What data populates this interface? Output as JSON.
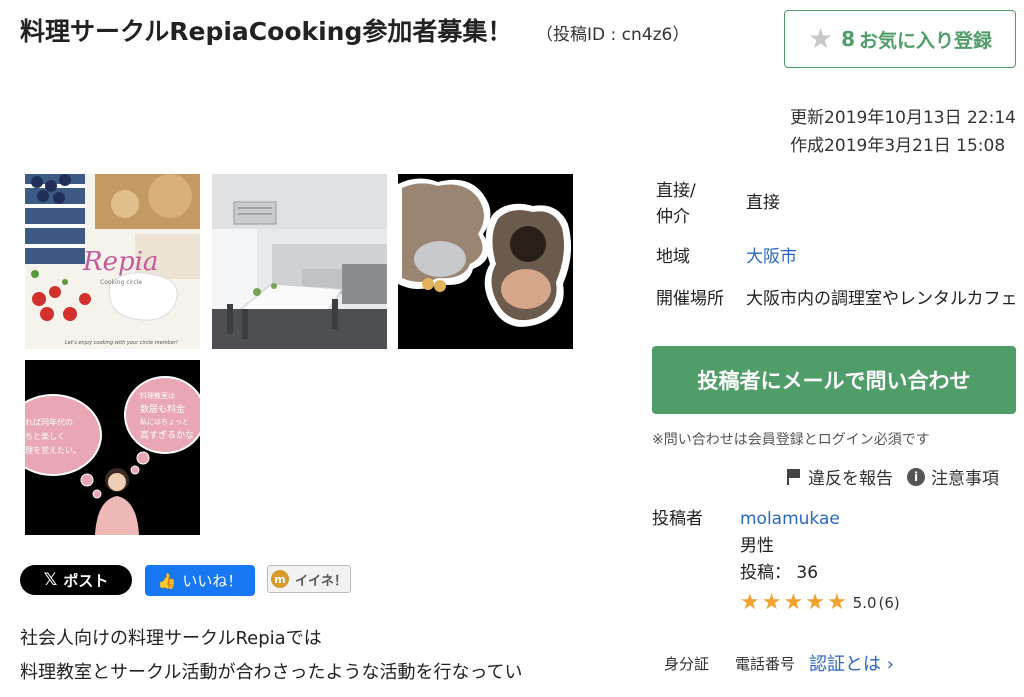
{
  "header": {
    "title": "料理サークルRepiaCooking参加者募集！",
    "post_id": "（投稿ID : cn4z6）"
  },
  "favorite": {
    "count": "8",
    "label": "お気に入り登録",
    "icon": "star-icon",
    "color": "#4f9d69"
  },
  "dates": {
    "updated": "更新2019年10月13日 22:14",
    "created": "作成2019年3月21日 15:08"
  },
  "gallery": {
    "img1_logo": "Repia",
    "img1_sub": "Cooking circle",
    "img1_caption": "Let's enjoy cooking with your circle member!",
    "img4_bubble_left": "れば同年代の\nちと楽しく\n理を覚えたい。",
    "img4_bubble_right": "料理教室は\n数居も料金\n私にはちょっと\n高すぎるかな"
  },
  "info": {
    "type_label": "直接/\n仲介",
    "type_value": "直接",
    "area_label": "地域",
    "area_value": "大阪市",
    "venue_label": "開催場所",
    "venue_value": "大阪市内の調理室やレンタルカフェ"
  },
  "contact": {
    "button_label": "投稿者にメールで問い合わせ",
    "note": "※問い合わせは会員登録とログイン必須です"
  },
  "report": {
    "report_label": "違反を報告",
    "notice_label": "注意事項"
  },
  "poster": {
    "label": "投稿者",
    "name": "molamukae",
    "gender": "男性",
    "posts": "投稿： 36",
    "rating": "5.0",
    "rating_count": "(6)",
    "stars": 5
  },
  "verification": {
    "id_label": "身分証",
    "phone_label": "電話番号",
    "link_label": "認証とは ›"
  },
  "share": {
    "x_label": "ポスト",
    "fb_label": "いいね！",
    "mixi_label": "イイネ！"
  },
  "description": [
    "社会人向けの料理サークルRepiaでは",
    "料理教室とサークル活動が合わさったような活動を行なってい"
  ],
  "colors": {
    "accent_green": "#4f9d69",
    "link_blue": "#2a67c4",
    "star_orange": "#f0a330"
  }
}
